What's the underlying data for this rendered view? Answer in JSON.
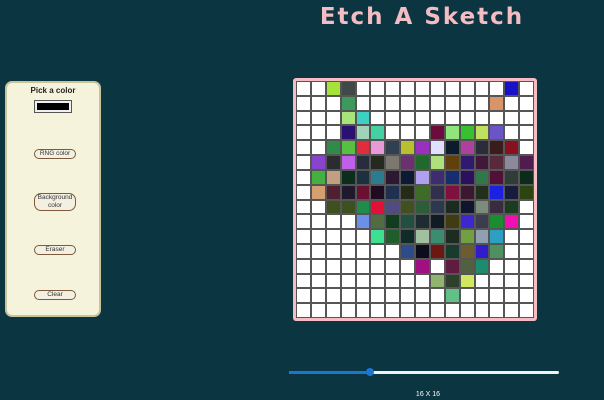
{
  "title": "Etch A Sketch",
  "controls": {
    "pick_color_label": "Pick a color",
    "selected_color": "#000000",
    "rng_button": "RNG color",
    "background_button": "Background color",
    "eraser_button": "Eraser",
    "clear_button": "Clear"
  },
  "grid": {
    "size_label": "16 X 16",
    "slider_value_fraction": 0.3,
    "frame_color": "#f4bcc3",
    "empty_color": "#ffffff",
    "cells": [
      [
        "#ffffff",
        "#ffffff",
        "#a6e33a",
        "#404848",
        "#ffffff",
        "#ffffff",
        "#ffffff",
        "#ffffff",
        "#ffffff",
        "#ffffff",
        "#ffffff",
        "#ffffff",
        "#ffffff",
        "#ffffff",
        "#1a10c8",
        "#ffffff"
      ],
      [
        "#ffffff",
        "#ffffff",
        "#ffffff",
        "#3e9a5c",
        "#ffffff",
        "#ffffff",
        "#ffffff",
        "#ffffff",
        "#ffffff",
        "#ffffff",
        "#ffffff",
        "#ffffff",
        "#ffffff",
        "#d8956a",
        "#ffffff",
        "#ffffff"
      ],
      [
        "#ffffff",
        "#ffffff",
        "#ffffff",
        "#a7e47c",
        "#3fd0c4",
        "#ffffff",
        "#ffffff",
        "#ffffff",
        "#ffffff",
        "#ffffff",
        "#ffffff",
        "#ffffff",
        "#ffffff",
        "#ffffff",
        "#ffffff",
        "#ffffff"
      ],
      [
        "#ffffff",
        "#ffffff",
        "#ffffff",
        "#2a1070",
        "#a0d4b8",
        "#44d0a0",
        "#ffffff",
        "#ffffff",
        "#ffffff",
        "#6a0c3c",
        "#90e47c",
        "#38c030",
        "#c0e060",
        "#6a54c8",
        "#ffffff",
        "#ffffff"
      ],
      [
        "#ffffff",
        "#ffffff",
        "#2e8c48",
        "#58c040",
        "#e02c3c",
        "#e89ad8",
        "#304050",
        "#b8c030",
        "#9a30c0",
        "#e0e0ff",
        "#0c1c2c",
        "#b040a0",
        "#2a2c3c",
        "#3a1c1c",
        "#8a1020",
        "#ffffff"
      ],
      [
        "#ffffff",
        "#8844cc",
        "#2a2c30",
        "#c060e8",
        "#282c3c",
        "#242a20",
        "#7c7870",
        "#6a3070",
        "#20682c",
        "#b0e07c",
        "#60400c",
        "#301a70",
        "#401838",
        "#58283c",
        "#8a8a9c",
        "#501c50"
      ],
      [
        "#ffffff",
        "#44b040",
        "#c0a080",
        "#0c2c1c",
        "#1c3040",
        "#2c7c90",
        "#2c1830",
        "#0c1a34",
        "#b0a0f0",
        "#3c2c70",
        "#182c70",
        "#2c1060",
        "#30784c",
        "#501038",
        "#303c38",
        "#0a2c1c"
      ],
      [
        "#ffffff",
        "#d4a070",
        "#502030",
        "#20182c",
        "#6a1030",
        "#200c20",
        "#203050",
        "#242c18",
        "#3c6c28",
        "#30304c",
        "#801040",
        "#3c1830",
        "#20301c",
        "#1c20e0",
        "#181c3c",
        "#2c4410"
      ],
      [
        "#ffffff",
        "#ffffff",
        "#40501c",
        "#3c5020",
        "#208c4c",
        "#e01038",
        "#504c80",
        "#405020",
        "#2c5c38",
        "#2c3850",
        "#1c2a20",
        "#10142c",
        "#7c8c7c",
        "#382c40",
        "#1c3c20",
        "#ffffff"
      ],
      [
        "#ffffff",
        "#ffffff",
        "#ffffff",
        "#ffffff",
        "#6c90e8",
        "#506c40",
        "#103c20",
        "#205040",
        "#1c2c30",
        "#101c24",
        "#403c10",
        "#3c28cc",
        "#3c3c50",
        "#1c8c30",
        "#f010b0",
        "#ffffff"
      ],
      [
        "#ffffff",
        "#ffffff",
        "#ffffff",
        "#ffffff",
        "#ffffff",
        "#3ce090",
        "#205c2c",
        "#102c28",
        "#a0c0a0",
        "#3c8c70",
        "#1c2c20",
        "#70a040",
        "#90a0b0",
        "#2ca0c0",
        "#ffffff",
        "#ffffff"
      ],
      [
        "#ffffff",
        "#ffffff",
        "#ffffff",
        "#ffffff",
        "#ffffff",
        "#ffffff",
        "#ffffff",
        "#2c4c8c",
        "#0c0c1c",
        "#6c1810",
        "#183c2c",
        "#6c5c30",
        "#301ccc",
        "#509060",
        "#ffffff",
        "#ffffff"
      ],
      [
        "#ffffff",
        "#ffffff",
        "#ffffff",
        "#ffffff",
        "#ffffff",
        "#ffffff",
        "#ffffff",
        "#ffffff",
        "#a01080",
        "#ffffff",
        "#601c40",
        "#506040",
        "#1c8c6c",
        "#ffffff",
        "#ffffff",
        "#ffffff"
      ],
      [
        "#ffffff",
        "#ffffff",
        "#ffffff",
        "#ffffff",
        "#ffffff",
        "#ffffff",
        "#ffffff",
        "#ffffff",
        "#ffffff",
        "#90b470",
        "#2c402c",
        "#d0e860",
        "#ffffff",
        "#ffffff",
        "#ffffff",
        "#ffffff"
      ],
      [
        "#ffffff",
        "#ffffff",
        "#ffffff",
        "#ffffff",
        "#ffffff",
        "#ffffff",
        "#ffffff",
        "#ffffff",
        "#ffffff",
        "#ffffff",
        "#60c088",
        "#ffffff",
        "#ffffff",
        "#ffffff",
        "#ffffff",
        "#ffffff"
      ],
      [
        "#ffffff",
        "#ffffff",
        "#ffffff",
        "#ffffff",
        "#ffffff",
        "#ffffff",
        "#ffffff",
        "#ffffff",
        "#ffffff",
        "#ffffff",
        "#ffffff",
        "#ffffff",
        "#ffffff",
        "#ffffff",
        "#ffffff",
        "#ffffff"
      ]
    ]
  }
}
